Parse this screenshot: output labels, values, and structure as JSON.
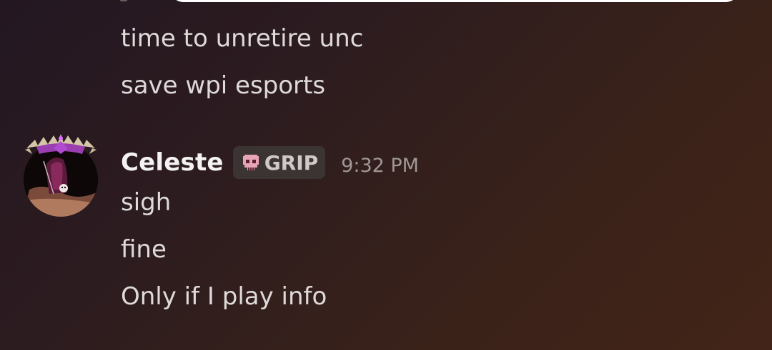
{
  "chat": {
    "previous_messages": [
      "time to unretire unc",
      "save wpi esports"
    ],
    "message_group": {
      "author": "Celeste",
      "tag_label": "GRIP",
      "tag_icon": "skull-icon",
      "timestamp": "9:32 PM",
      "lines": [
        "sigh",
        "fine",
        "Only if I play info"
      ]
    }
  },
  "colors": {
    "tag_icon_pink": "#e8a4b8",
    "background_start": "#231722",
    "background_end": "#432418"
  }
}
